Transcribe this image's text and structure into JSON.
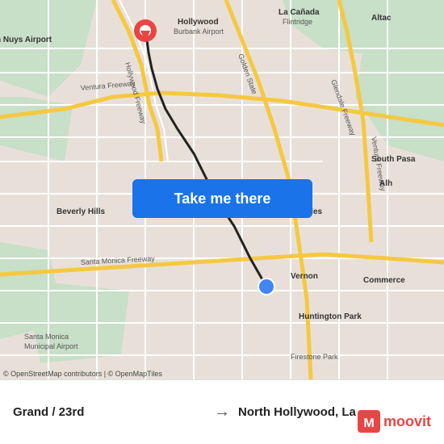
{
  "map": {
    "attribution": "© OpenStreetMap contributors | © OpenMapTiles",
    "button_label": "Take me there"
  },
  "bottom_bar": {
    "from": "Grand / 23rd",
    "to": "North Hollywood, La",
    "arrow": "→",
    "logo_text": "moovit"
  },
  "icons": {
    "destination_pin": "📍",
    "origin_dot": "●"
  }
}
